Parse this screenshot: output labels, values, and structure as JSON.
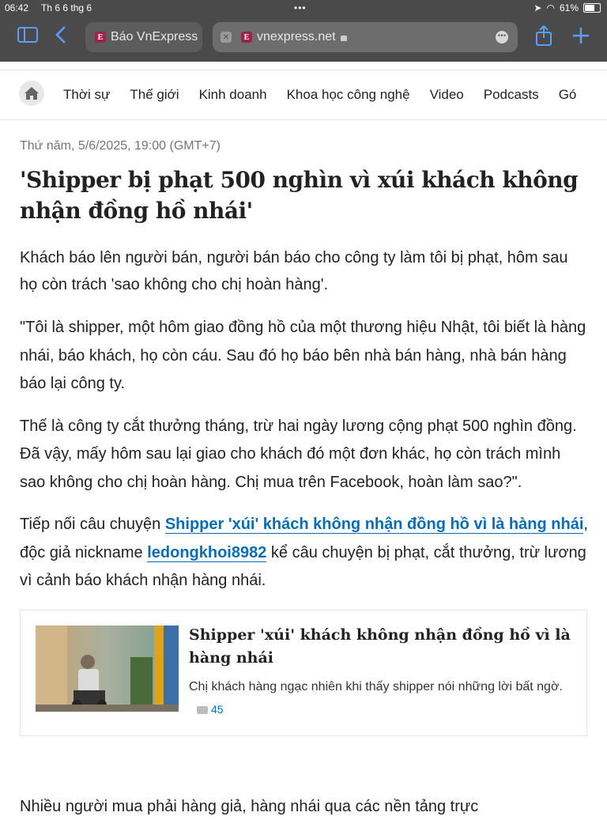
{
  "status_bar": {
    "time": "06:42",
    "date": "Th 6 6 thg 6",
    "battery": "61%"
  },
  "browser": {
    "tabs": [
      {
        "label": "Báo VnExpress"
      },
      {
        "label": "vnexpress.net"
      }
    ],
    "accent": "#5aa0ff"
  },
  "nav": {
    "items": [
      "Thời sự",
      "Thế giới",
      "Kinh doanh",
      "Khoa học công nghệ",
      "Video",
      "Podcasts",
      "Gó"
    ]
  },
  "article": {
    "date": "Thứ năm, 5/6/2025, 19:00 (GMT+7)",
    "title": "'Shipper bị phạt 500 nghìn vì xúi khách không nhận đồng hồ nhái'",
    "lead": "Khách báo lên người bán, người bán báo cho công ty làm tôi bị phạt, hôm sau họ còn trách 'sao không cho chị hoàn hàng'.",
    "p1": "\"Tôi là shipper, một hôm giao đồng hồ của một thương hiệu Nhật, tôi biết là hàng nhái, báo khách, họ còn cáu. Sau đó họ báo bên nhà bán hàng, nhà bán hàng báo lại công ty.",
    "p2": "Thế là công ty cắt thưởng tháng, trừ hai ngày lương cộng phạt 500 nghìn đồng. Đã vậy, mấy hôm sau lại giao cho khách đó một đơn khác, họ còn trách mình sao không cho chị hoàn hàng. Chị mua trên Facebook, hoàn làm sao?\".",
    "p3_part1": "Tiếp nối câu chuyện ",
    "p3_link1": "Shipper 'xúi' khách không nhận đồng hồ vì là hàng nhái",
    "p3_part2": ", độc giả nickname ",
    "p3_link2": "ledongkhoi8982",
    "p3_part3": " kể câu chuyện bị phạt, cắt thưởng, trừ lương vì cảnh báo khách nhận hàng nhái.",
    "p4_partial": "Nhiều người mua phải hàng giả, hàng nhái qua các nền tảng trực"
  },
  "related": {
    "title": "Shipper 'xúi' khách không nhận đồng hồ vì là hàng nhái",
    "desc": "Chị khách hàng ngạc nhiên khi thấy shipper nói những lời bất ngờ.",
    "comments": "45"
  },
  "colors": {
    "link": "#076db6",
    "brand": "#9f224e"
  }
}
